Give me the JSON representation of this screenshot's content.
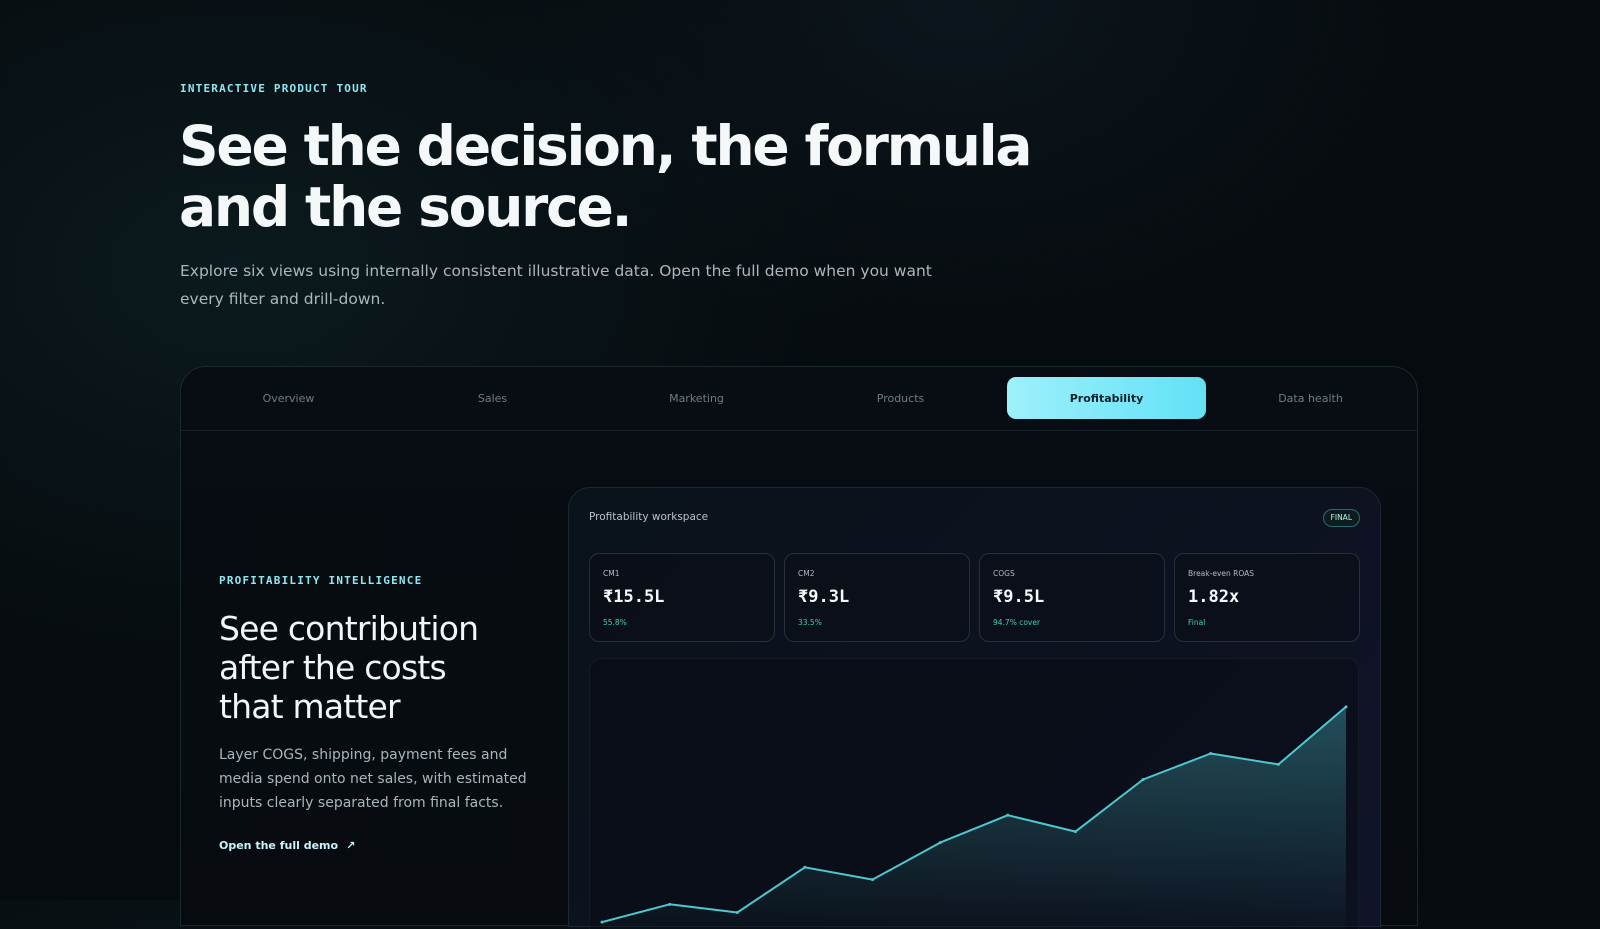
{
  "hero": {
    "eyebrow": "INTERACTIVE PRODUCT TOUR",
    "title_line1": "See the decision, the formula",
    "title_line2": "and the source.",
    "subtitle": "Explore six views using internally consistent illustrative data. Open the full demo when you want every filter and drill-down."
  },
  "tabs": [
    {
      "label": "Overview",
      "active": false
    },
    {
      "label": "Sales",
      "active": false
    },
    {
      "label": "Marketing",
      "active": false
    },
    {
      "label": "Products",
      "active": false
    },
    {
      "label": "Profitability",
      "active": true
    },
    {
      "label": "Data health",
      "active": false
    }
  ],
  "section": {
    "eyebrow": "PROFITABILITY INTELLIGENCE",
    "title_line1": "See contribution",
    "title_line2": "after the costs",
    "title_line3": "that matter",
    "description": "Layer COGS, shipping, payment fees and media spend onto net sales, with estimated inputs clearly separated from final facts.",
    "link_label": "Open the full demo",
    "link_icon": "arrow-up-right-icon"
  },
  "workspace": {
    "title": "Profitability workspace",
    "badge": "FINAL",
    "kpis": [
      {
        "label": "CM1",
        "value": "₹15.5L",
        "sub": "55.8%"
      },
      {
        "label": "CM2",
        "value": "₹9.3L",
        "sub": "33.5%"
      },
      {
        "label": "COGS",
        "value": "₹9.5L",
        "sub": "94.7% cover"
      },
      {
        "label": "Break-even ROAS",
        "value": "1.82x",
        "sub": "Final"
      }
    ]
  },
  "colors": {
    "accent": "#62e1f6",
    "line": "#4fc7cf",
    "positive": "#42d0b4",
    "background": "#060b0f"
  },
  "chart_data": {
    "type": "area",
    "x": [
      1,
      2,
      3,
      4,
      5,
      6,
      7,
      8,
      9,
      10,
      11,
      12
    ],
    "values": [
      5,
      18,
      12,
      45,
      36,
      63,
      83,
      71,
      109,
      128,
      120,
      162
    ],
    "ylim": [
      0,
      175
    ],
    "grid": false
  }
}
